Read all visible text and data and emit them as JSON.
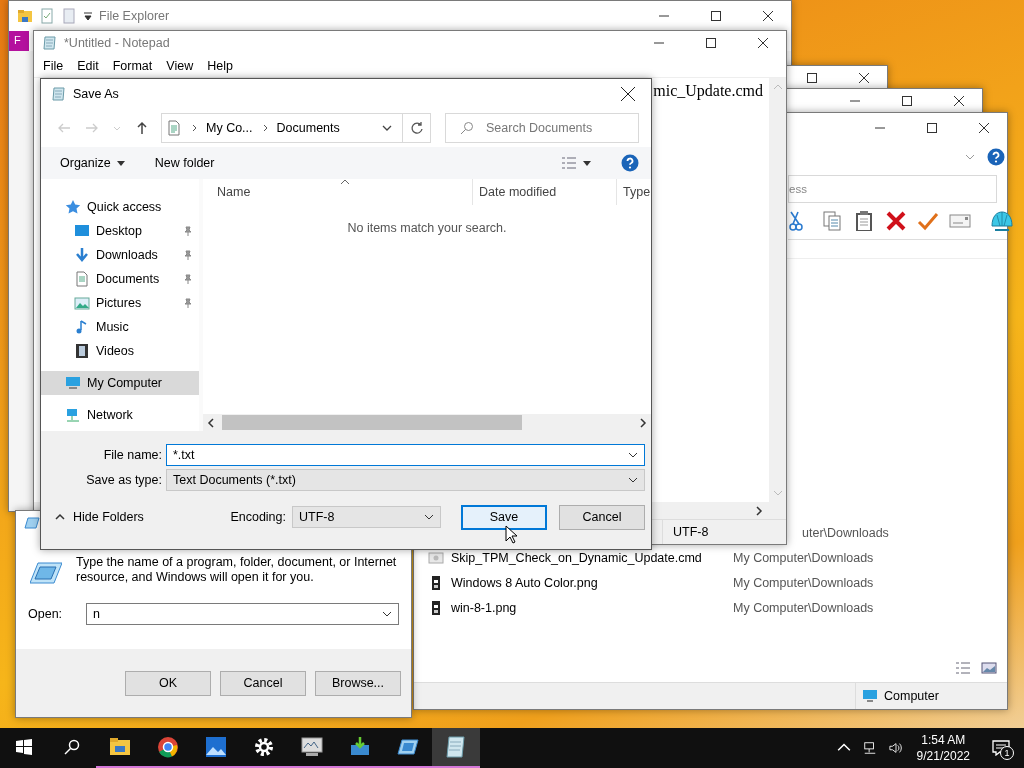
{
  "file_explorer": {
    "title": "File Explorer",
    "ribbon_tab": "F"
  },
  "downloads_window": {
    "address_text": "ess",
    "files": [
      {
        "location": "uter\\Downloads"
      },
      {
        "name": "Skip_TPM_Check_on_Dynamic_Update.cmd",
        "location": "My Computer\\Downloads",
        "kind": "script"
      },
      {
        "name": "Windows 8 Auto Color.png",
        "location": "My Computer\\Downloads",
        "kind": "image"
      },
      {
        "name": "win-8-1.png",
        "location": "My Computer\\Downloads",
        "kind": "image"
      }
    ],
    "status_location": "Computer"
  },
  "notepad": {
    "title": "*Untitled - Notepad",
    "menu": [
      "File",
      "Edit",
      "Format",
      "View",
      "Help"
    ],
    "text": "mic_Update.cmd",
    "encoding": "UTF-8"
  },
  "run_dialog": {
    "description": "Type the name of a program, folder, document, or Internet resource, and Windows will open it for you.",
    "open_label": "Open:",
    "open_value": "n",
    "buttons": [
      "OK",
      "Cancel",
      "Browse..."
    ]
  },
  "save_as": {
    "title": "Save As",
    "breadcrumb": [
      "My Co...",
      "Documents"
    ],
    "search_placeholder": "Search Documents",
    "toolbar": [
      "Organize",
      "New folder"
    ],
    "nav": [
      {
        "label": "Quick access",
        "kind": "star",
        "selected": false,
        "children": [
          {
            "label": "Desktop",
            "kind": "desktop",
            "pinned": true,
            "selected": false
          },
          {
            "label": "Downloads",
            "kind": "download",
            "pinned": true,
            "selected": false
          },
          {
            "label": "Documents",
            "kind": "document",
            "pinned": true,
            "selected": false
          },
          {
            "label": "Pictures",
            "kind": "picture",
            "pinned": true,
            "selected": false
          },
          {
            "label": "Music",
            "kind": "music",
            "pinned": false,
            "selected": false
          },
          {
            "label": "Videos",
            "kind": "video",
            "pinned": false,
            "selected": false
          }
        ]
      },
      {
        "label": "My Computer",
        "kind": "computer",
        "selected": true
      },
      {
        "label": "Network",
        "kind": "network",
        "selected": false
      }
    ],
    "columns": [
      "Name",
      "Date modified",
      "Type"
    ],
    "empty_message": "No items match your search.",
    "file_name_label": "File name:",
    "file_name": "*.txt",
    "type_label": "Save as type:",
    "type_value": "Text Documents (*.txt)",
    "hide_folders": "Hide Folders",
    "encoding_label": "Encoding:",
    "encoding": "UTF-8",
    "buttons": [
      {
        "label": "Save",
        "default": true
      },
      {
        "label": "Cancel",
        "default": false
      }
    ]
  },
  "taskbar": {
    "apps": [
      {
        "kind": "folder",
        "running": true,
        "active": false
      },
      {
        "kind": "browser",
        "running": true,
        "active": false
      },
      {
        "kind": "photos",
        "running": true,
        "active": false
      },
      {
        "kind": "settings",
        "running": true,
        "active": false
      },
      {
        "kind": "monitor",
        "running": true,
        "active": false
      },
      {
        "kind": "download",
        "running": true,
        "active": false
      },
      {
        "kind": "screen",
        "running": true,
        "active": false
      },
      {
        "kind": "notepad",
        "running": true,
        "active": true
      }
    ],
    "time": "1:54 AM",
    "date": "9/21/2022",
    "notifications": "1"
  }
}
